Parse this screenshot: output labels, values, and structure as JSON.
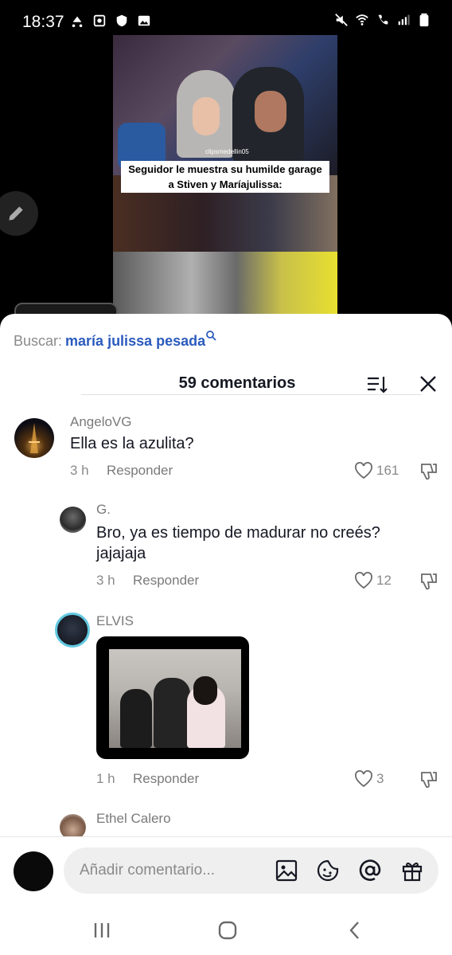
{
  "status_bar": {
    "time": "18:37",
    "left_icons": [
      "incognito-icon",
      "sim-icon",
      "shield-icon",
      "image-icon"
    ],
    "right_icons": [
      "mute-icon",
      "wifi-icon",
      "call-icon",
      "signal-icon",
      "battery-icon"
    ]
  },
  "video": {
    "watermark": "clipsmedellin05",
    "caption": "Seguidor le muestra su humilde garage a Stiven y Maríajulissa:"
  },
  "search": {
    "prefix": "Buscar:",
    "query": "maría julissa pesada"
  },
  "header": {
    "title": "59 comentarios"
  },
  "comments": [
    {
      "author": "AngeloVG",
      "text": "Ella es la azulita?",
      "time": "3 h",
      "reply": "Responder",
      "likes": "161"
    },
    {
      "author": "G.",
      "text": "Bro, ya es tiempo de madurar no creés? jajajaja",
      "time": "3 h",
      "reply": "Responder",
      "likes": "12"
    },
    {
      "author": "ELVIS",
      "text": "",
      "time": "1 h",
      "reply": "Responder",
      "likes": "3"
    },
    {
      "author": "Ethel Calero",
      "text": ""
    }
  ],
  "input": {
    "placeholder": "Añadir comentario..."
  },
  "colors": {
    "accent_blue": "#2b5bbd",
    "text_dark": "#161823",
    "text_gray": "#8a8a8a"
  }
}
